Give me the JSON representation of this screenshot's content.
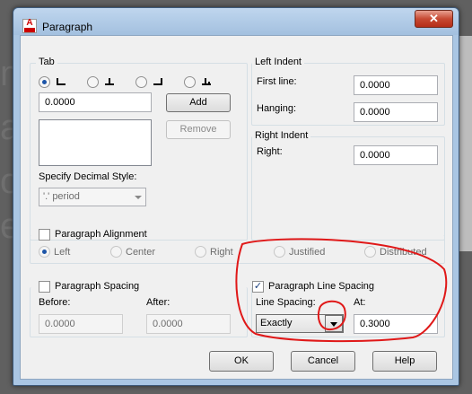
{
  "window": {
    "title": "Paragraph"
  },
  "tab": {
    "legend": "Tab",
    "stop_value": "0.0000",
    "add_label": "Add",
    "remove_label": "Remove",
    "decimal_label": "Specify Decimal Style:",
    "decimal_value": "'.' period"
  },
  "left_indent": {
    "legend": "Left Indent",
    "first_line_label": "First line:",
    "first_line_value": "0.0000",
    "hanging_label": "Hanging:",
    "hanging_value": "0.0000"
  },
  "right_indent": {
    "legend": "Right Indent",
    "right_label": "Right:",
    "right_value": "0.0000"
  },
  "alignment": {
    "label": "Paragraph Alignment",
    "options": [
      "Left",
      "Center",
      "Right",
      "Justified",
      "Distributed"
    ]
  },
  "spacing": {
    "label": "Paragraph Spacing",
    "before_label": "Before:",
    "before_value": "0.0000",
    "after_label": "After:",
    "after_value": "0.0000"
  },
  "line_spacing": {
    "label": "Paragraph Line Spacing",
    "type_label": "Line Spacing:",
    "type_value": "Exactly",
    "at_label": "At:",
    "at_value": "0.3000"
  },
  "buttons": {
    "ok": "OK",
    "cancel": "Cancel",
    "help": "Help"
  },
  "colors": {
    "annotation": "#e01818",
    "titlebar": "#a3c0df",
    "close": "#c74a33"
  }
}
